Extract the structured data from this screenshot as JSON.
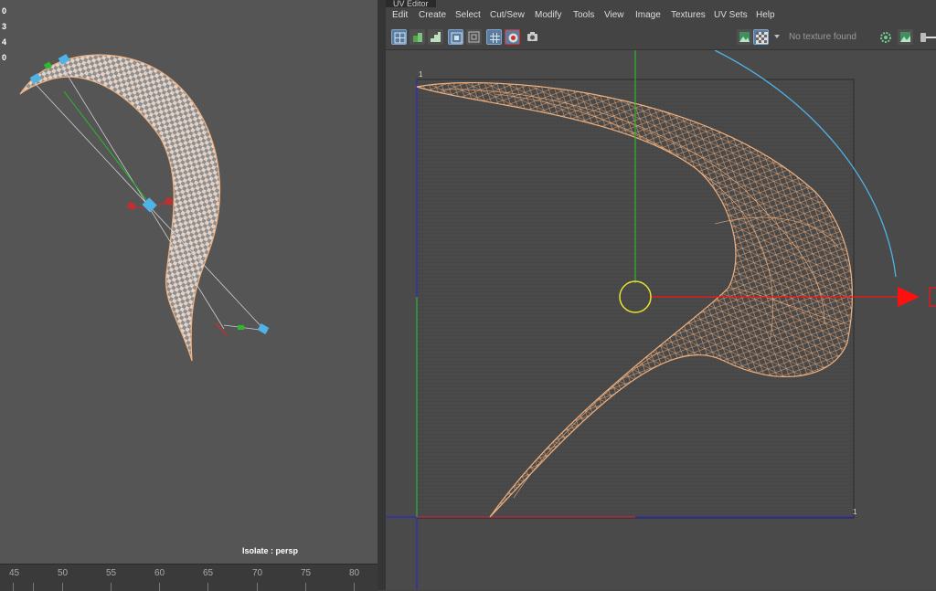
{
  "viewport": {
    "hud_lines": [
      "0",
      "3",
      "4",
      "0"
    ],
    "isolate_label": "Isolate : persp"
  },
  "timeline": {
    "ticks": [
      "45",
      "50",
      "55",
      "60",
      "65",
      "70",
      "75",
      "80"
    ]
  },
  "uv_editor": {
    "title": "UV Editor",
    "menu": [
      "Edit",
      "Create",
      "Select",
      "Cut/Sew",
      "Modify",
      "Tools",
      "View",
      "Image",
      "Textures",
      "UV Sets",
      "Help"
    ],
    "texture_status": "No texture found",
    "grid_labels": {
      "top_left": "1",
      "bottom_right": "1"
    }
  },
  "colors": {
    "mesh": "#f0b07e",
    "grid_bg": "#474747",
    "u_axis": "#c03030",
    "v_axis": "#2db82d",
    "grid_border": "#2a2acc",
    "rotate_ring": "#4fb3e6",
    "manip_ring": "#e6e630",
    "move_arrow": "#ff1010"
  },
  "icons": {
    "toolbar": [
      "uv-grid-icon",
      "uv-shell-icon",
      "uv-stairs-icon",
      "uv-frame-icon",
      "uv-frame-outline-icon",
      "grid-toggle-icon",
      "shaded-uv-icon",
      "snapshot-icon",
      "image-display-icon",
      "checker-icon",
      "dropdown-arrow-icon",
      "gear-cog-icon",
      "image-icon"
    ]
  }
}
